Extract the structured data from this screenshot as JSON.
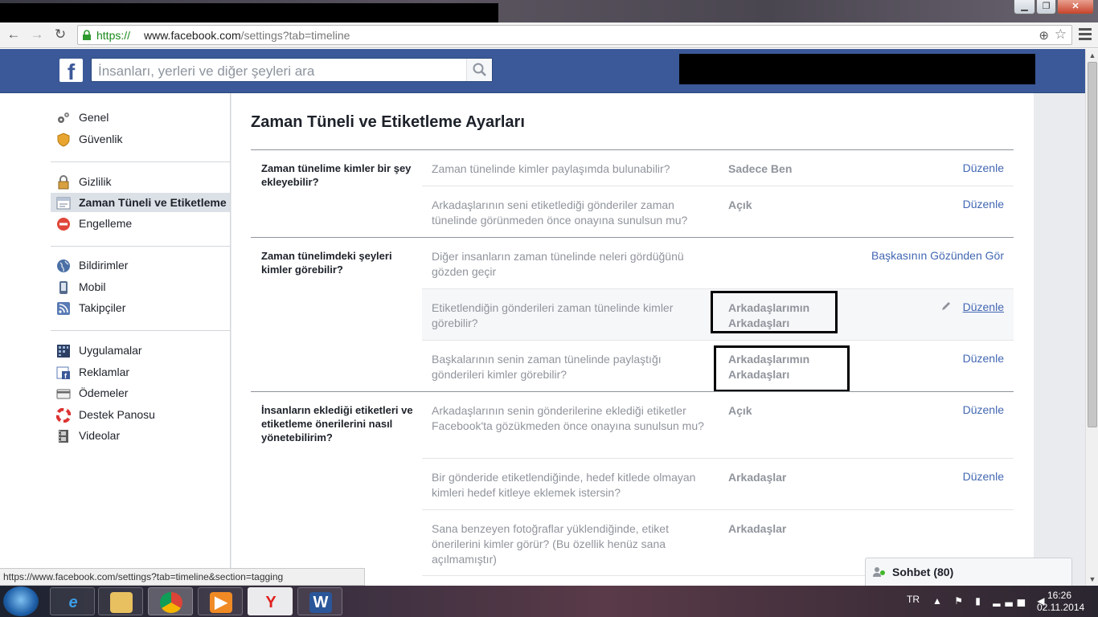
{
  "browser": {
    "url_scheme": "https://",
    "url_host": "www.facebook.com",
    "url_path": "/settings?tab=timeline",
    "status_url": "https://www.facebook.com/settings?tab=timeline&section=tagging"
  },
  "header": {
    "logo": "f",
    "search_placeholder": "İnsanları, yerleri ve diğer şeyleri ara"
  },
  "sidebar": {
    "items": [
      {
        "label": "Genel",
        "icon": "gears-icon"
      },
      {
        "label": "Güvenlik",
        "icon": "shield-icon"
      },
      {
        "label": "Gizlilik",
        "icon": "lock-icon"
      },
      {
        "label": "Zaman Tüneli ve Etiketleme",
        "icon": "timeline-icon",
        "active": true
      },
      {
        "label": "Engelleme",
        "icon": "block-icon"
      },
      {
        "label": "Bildirimler",
        "icon": "globe-icon"
      },
      {
        "label": "Mobil",
        "icon": "mobile-icon"
      },
      {
        "label": "Takipçiler",
        "icon": "rss-icon"
      },
      {
        "label": "Uygulamalar",
        "icon": "apps-icon"
      },
      {
        "label": "Reklamlar",
        "icon": "ads-icon"
      },
      {
        "label": "Ödemeler",
        "icon": "card-icon"
      },
      {
        "label": "Destek Panosu",
        "icon": "lifebuoy-icon"
      },
      {
        "label": "Videolar",
        "icon": "film-icon"
      }
    ]
  },
  "main": {
    "title": "Zaman Tüneli ve Etiketleme Ayarları",
    "sections": [
      {
        "heading": "Zaman tünelime kimler bir şey ekleyebilir?",
        "rows": [
          {
            "question": "Zaman tünelinde kimler paylaşımda bulunabilir?",
            "value": "Sadece Ben",
            "action": "Düzenle"
          },
          {
            "question": "Arkadaşlarının seni etiketlediği gönderiler zaman tünelinde görünmeden önce onayına sunulsun mu?",
            "value": "Açık",
            "action": "Düzenle"
          }
        ]
      },
      {
        "heading": "Zaman tünelimdeki şeyleri kimler görebilir?",
        "rows": [
          {
            "question": "Diğer insanların zaman tünelinde neleri gördüğünü gözden geçir",
            "value": "",
            "action": "Başkasının Gözünden Gör"
          },
          {
            "question": "Etiketlendiğin gönderileri zaman tünelinde kimler görebilir?",
            "value": "Arkadaşlarımın Arkadaşları",
            "action": "Düzenle"
          },
          {
            "question": "Başkalarının senin zaman tünelinde paylaştığı gönderileri kimler görebilir?",
            "value": "Arkadaşlarımın Arkadaşları",
            "action": "Düzenle"
          }
        ]
      },
      {
        "heading": "İnsanların eklediği etiketleri ve etiketleme önerilerini nasıl yönetebilirim?",
        "rows": [
          {
            "question": "Arkadaşlarının senin gönderilerine eklediği etiketler Facebook'ta gözükmeden önce onayına sunulsun mu?",
            "value": "Açık",
            "action": "Düzenle"
          },
          {
            "question": "Bir gönderide etiketlendiğinde, hedef kitlede olmayan kimleri hedef kitleye eklemek istersin?",
            "value": "Arkadaşlar",
            "action": "Düzenle"
          },
          {
            "question": "Sana benzeyen fotoğraflar yüklendiğinde, etiket önerilerini kimler görür? (Bu özellik henüz sana açılmamıştır)",
            "value": "Arkadaşlar",
            "action": ""
          }
        ]
      }
    ]
  },
  "chat": {
    "label": "Sohbet (80)"
  },
  "taskbar": {
    "apps": [
      "internet-explorer-icon",
      "file-explorer-icon",
      "chrome-icon",
      "media-player-icon",
      "yandex-icon",
      "word-icon"
    ],
    "lang": "TR",
    "time": "16:26",
    "date": "02.11.2014"
  },
  "colors": {
    "fb_blue": "#3b5998",
    "link": "#4267b2",
    "muted": "#90949c"
  }
}
